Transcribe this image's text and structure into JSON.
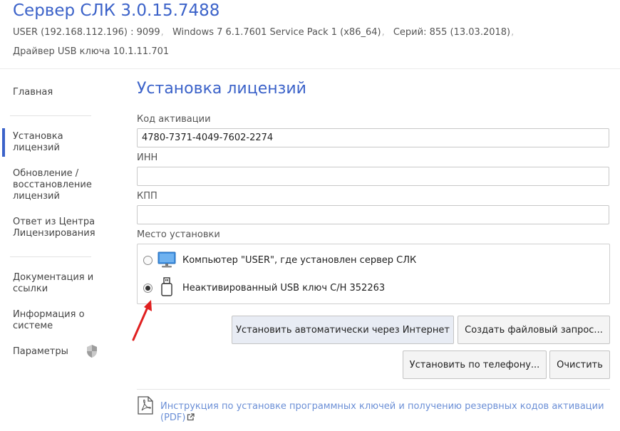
{
  "header": {
    "title": "Сервер СЛК 3.0.15.7488",
    "user": "USER (192.168.112.196) : 9099",
    "os": "Windows 7 6.1.7601 Service Pack 1 (x86_64)",
    "series": "Серий: 855 (13.03.2018)",
    "separator": ",",
    "driver": "Драйвер USB ключа 10.1.11.701"
  },
  "sidebar": {
    "items": [
      {
        "label": "Главная"
      },
      {
        "label": "Установка лицензий",
        "active": true
      },
      {
        "label": "Обновление / восстановление лицензий"
      },
      {
        "label": "Ответ из Центра Лицензирования"
      },
      {
        "label": "Документация и ссылки"
      },
      {
        "label": "Информация о системе"
      },
      {
        "label": "Параметры",
        "icon": "shield-icon"
      }
    ]
  },
  "main": {
    "title": "Установка лицензий",
    "fields": {
      "activation_code": {
        "label": "Код активации",
        "value": "4780-7371-4049-7602-2274"
      },
      "inn": {
        "label": "ИНН",
        "value": ""
      },
      "kpp": {
        "label": "КПП",
        "value": ""
      }
    },
    "install_place": {
      "label": "Место установки",
      "options": [
        {
          "label": "Компьютер \"USER\", где установлен сервер СЛК",
          "icon": "monitor-icon",
          "selected": false
        },
        {
          "label": "Неактивированный USB ключ С/Н 352263",
          "icon": "usb-key-icon",
          "selected": true
        }
      ]
    },
    "buttons": {
      "install_internet": "Установить автоматически через Интернет",
      "create_file_request": "Создать файловый запрос...",
      "install_phone": "Установить по телефону...",
      "clear": "Очистить"
    },
    "doc_link": {
      "text": "Инструкция по установке программных ключей и получению резервных кодов активации (PDF)",
      "icon": "external-link-icon"
    }
  },
  "annotation": {
    "icon": "red-arrow-icon"
  },
  "colors": {
    "accent": "#3b62c9",
    "link": "#6b8fd6",
    "annotation_arrow": "#e02020",
    "primary_button_bg": "#e8ecf4"
  }
}
